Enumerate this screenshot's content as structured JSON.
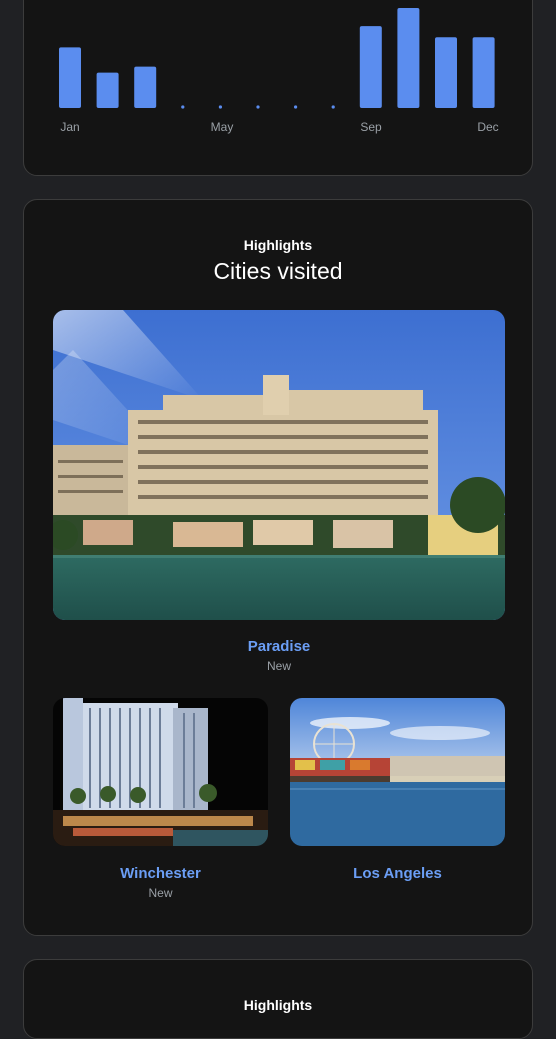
{
  "chart_data": {
    "type": "bar",
    "categories": [
      "Jan",
      "Feb",
      "Mar",
      "Apr",
      "May",
      "Jun",
      "Jul",
      "Aug",
      "Sep",
      "Oct",
      "Nov",
      "Dec"
    ],
    "values": [
      60,
      35,
      41,
      0,
      0,
      0,
      0,
      0,
      81,
      99,
      70,
      70
    ],
    "tick_labels": [
      "Jan",
      "May",
      "Sep",
      "Dec"
    ],
    "color": "#5b8def"
  },
  "highlights_card": {
    "kicker": "Highlights",
    "title": "Cities visited",
    "cities": [
      {
        "name": "Paradise",
        "subtitle": "New"
      },
      {
        "name": "Winchester",
        "subtitle": "New"
      },
      {
        "name": "Los Angeles",
        "subtitle": ""
      }
    ]
  },
  "next_card": {
    "kicker": "Highlights"
  }
}
